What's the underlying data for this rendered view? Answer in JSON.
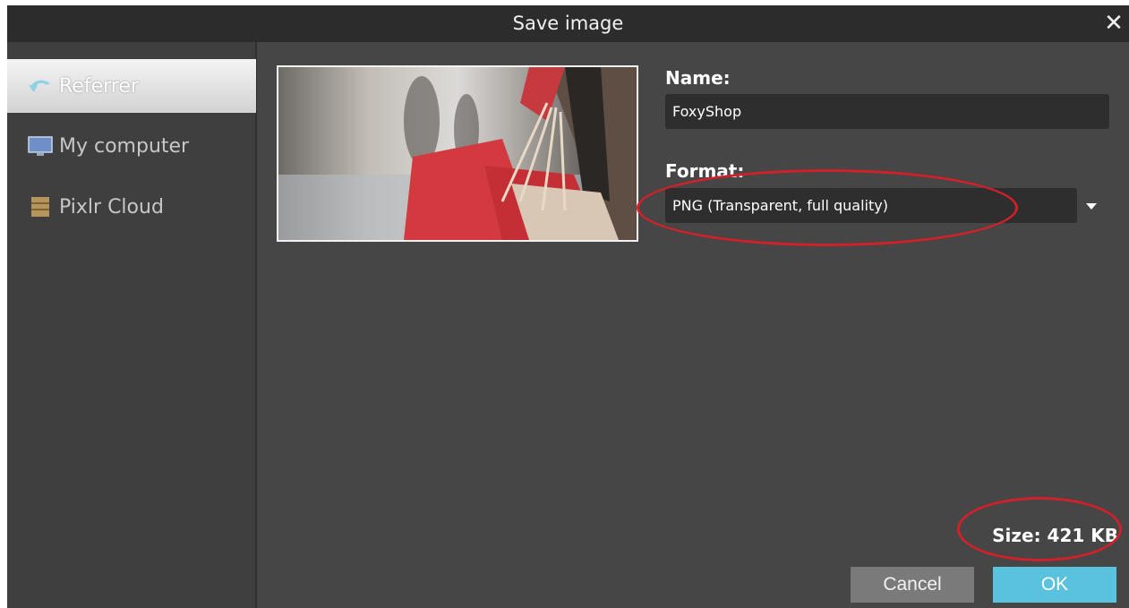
{
  "dialog": {
    "title": "Save image",
    "close_glyph": "✕"
  },
  "sidebar": {
    "items": [
      {
        "label": "Referrer",
        "icon": "referrer-arrow-icon",
        "active": true
      },
      {
        "label": "My computer",
        "icon": "monitor-icon",
        "active": false
      },
      {
        "label": "Pixlr Cloud",
        "icon": "cloud-storage-icon",
        "active": false
      }
    ]
  },
  "form": {
    "name_label": "Name:",
    "name_value": "FoxyShop",
    "format_label": "Format:",
    "format_value": "PNG (Transparent, full quality)",
    "size_text": "Size: 421 KB"
  },
  "buttons": {
    "cancel": "Cancel",
    "ok": "OK"
  },
  "colors": {
    "accent": "#5bc2de",
    "annotation": "#d0202a"
  }
}
